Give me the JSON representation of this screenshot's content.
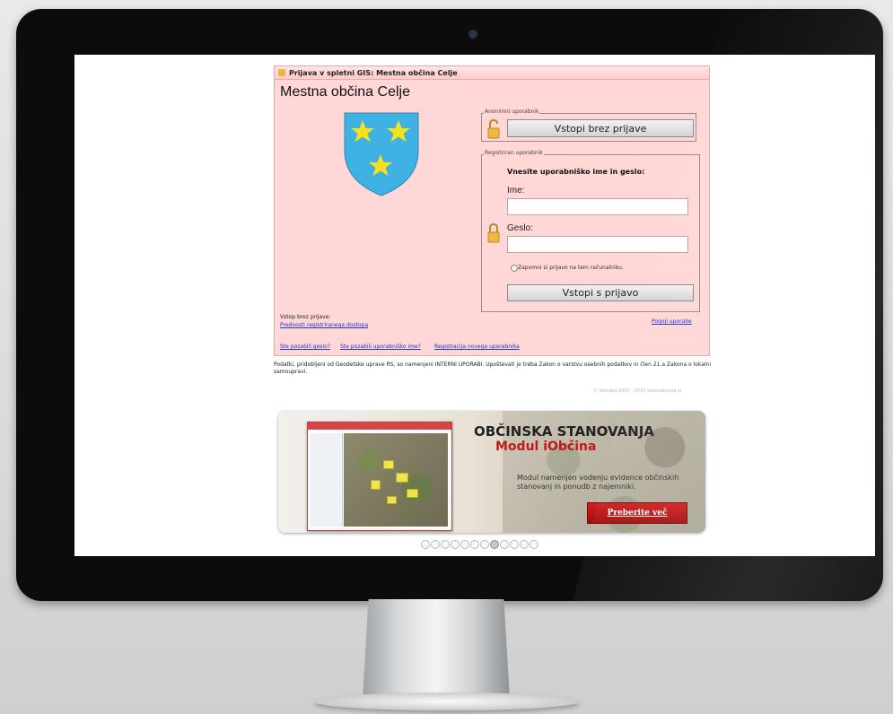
{
  "login": {
    "title_bar": "Prijava v spletni GIS: Mestna občina Celje",
    "heading": "Mestna občina Celje",
    "anonymous": {
      "legend": "Anonimni uporabnik",
      "button": "Vstopi brez prijave"
    },
    "registered": {
      "legend": "Registriran uporabnik",
      "prompt": "Vnesite uporabniško ime in geslo:",
      "username_label": "Ime:",
      "username_value": "",
      "password_label": "Geslo:",
      "password_value": "",
      "remember_label": "Zapomni si prijavo na tem računalniku.",
      "button": "Vstopi s prijavo"
    },
    "left_note_line1": "Vstop brez prijave:",
    "left_note_link": "Prednosti registriranega dostopa",
    "help_link": "Pogoji uporabe",
    "bottom_links": {
      "forgot_password": "Ste pozabili geslo?",
      "forgot_username": "Ste pozabili uporabniško ime?",
      "register": "Registracija novega uporabnika"
    }
  },
  "notice": "Podatki, pridobljeni od Geodetske uprave RS, so namenjeni INTERNI UPORABI. Upoštevati je treba Zakon o varstvu osebnih podatkov in člen 21.a Zakona o lokalni samoupravi.",
  "copyright": "© Kalcopa 2002 - 2015 www.kalcopa.si",
  "banner": {
    "title": "OBČINSKA STANOVANJA",
    "subtitle": "Modul iObčina",
    "description": "Modul namenjen vodenju evidence občinskih stanovanj in ponudb z najemniki.",
    "button": "Preberite več"
  },
  "carousel": {
    "count": 12,
    "active_index": 7
  },
  "colors": {
    "panel_bg": "#ffd7d7",
    "link": "#2233cc",
    "banner_accent": "#c21a1a"
  }
}
